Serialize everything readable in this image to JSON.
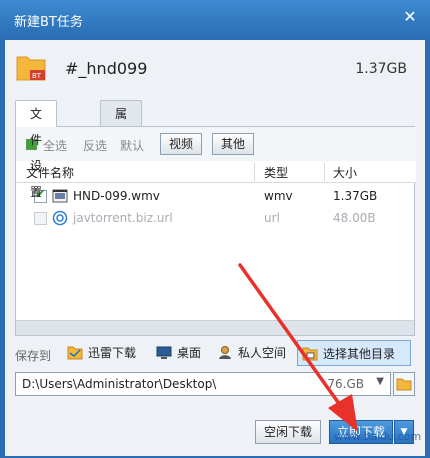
{
  "window": {
    "title": "新建BT任务"
  },
  "torrent": {
    "name": "#_hnd099",
    "total_size": "1.37GB"
  },
  "tabs": [
    {
      "label": "文件设置",
      "active": true
    },
    {
      "label": "属性设置",
      "active": false
    }
  ],
  "filters": {
    "select_all": "全选",
    "invert": "反选",
    "default": "默认",
    "video": "视频",
    "other": "其他"
  },
  "columns": {
    "name": "文件名称",
    "type": "类型",
    "size": "大小"
  },
  "files": [
    {
      "name": "HND-099.wmv",
      "type": "wmv",
      "size": "1.37GB",
      "checked": true,
      "icon": "video-file-icon"
    },
    {
      "name": "javtorrent.biz.url",
      "type": "url",
      "size": "48.00B",
      "checked": false,
      "icon": "url-file-icon"
    }
  ],
  "save": {
    "label": "保存到",
    "options": [
      {
        "label": "迅雷下载",
        "icon": "folder-icon"
      },
      {
        "label": "桌面",
        "icon": "desktop-icon"
      },
      {
        "label": "私人空间",
        "icon": "private-space-icon"
      },
      {
        "label": "选择其他目录",
        "icon": "folder-browse-icon",
        "selected": true
      }
    ],
    "path": "D:\\Users\\Administrator\\Desktop\\",
    "free_space": "76.GB"
  },
  "buttons": {
    "idle_download": "空闲下载",
    "download": "立即下载"
  },
  "watermark": "www.baidu.com",
  "colors": {
    "accent": "#2a6db3",
    "annotation": "#e8312a"
  }
}
